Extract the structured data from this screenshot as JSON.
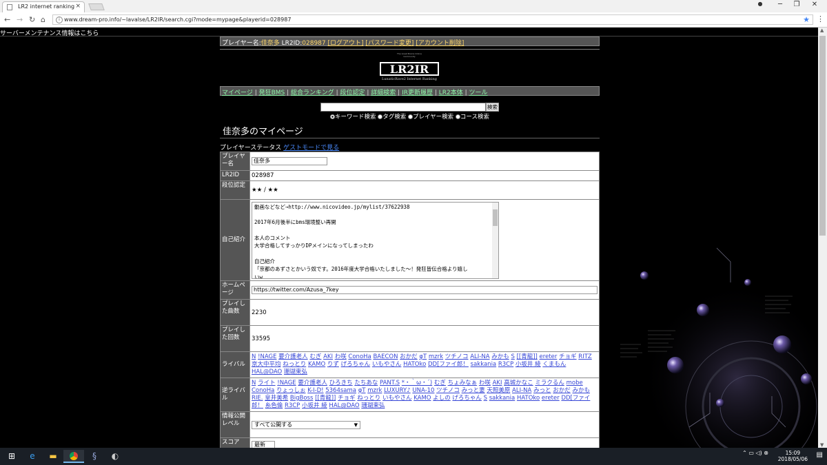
{
  "browser": {
    "tab_title": "LR2 internet ranking",
    "tab_close": "×",
    "url": "www.dream-pro.info/~lavalse/LR2IR/search.cgi?mode=mypage&playerid=028987",
    "win_min": "─",
    "win_max": "❐",
    "win_close": "✕"
  },
  "page": {
    "maintenance_link": "サーバーメンテナンス情報はこちら",
    "userbar": {
      "prefix": "プレイヤー名:",
      "player_name": "佳奈多",
      "id_prefix": " LR2ID:",
      "id": "028987",
      "logout": "[ログアウト]",
      "change_password": "[パスワード変更]",
      "delete_account": "[アカウント削除]"
    },
    "logo": {
      "title": "LR2IR",
      "subtitle": "LunaticRave2 Internet Ranking",
      "tiny": "The Great Brains Online Community"
    },
    "nav": [
      "マイページ",
      "発狂BMS",
      "総合ランキング",
      "段位認定",
      "詳細検索",
      "IR更新履歴",
      "LR2本体",
      "ツール"
    ],
    "search": {
      "button": "検索",
      "options": [
        "キーワード検索",
        "タグ検索",
        "プレイヤー検索",
        "コース検索"
      ],
      "selected_index": 0
    },
    "title": "佳奈多のマイページ",
    "status_label": "プレイヤーステータス",
    "guest_link": "ゲストモードで見る",
    "profile": {
      "player_name_label": "プレイヤー名",
      "player_name": "佳奈多",
      "lr2id_label": "LR2ID",
      "lr2id": "028987",
      "dan_label": "段位認定",
      "dan": "★★ / ★★",
      "intro_label": "自己紹介",
      "intro_lines": [
        "動画などなど→http://www.nicovideo.jp/mylist/37622938",
        "",
        "2017年6月後半にbms環境整い再開",
        "",
        "本人のコメント",
        "大学合格してすっかりDPメインになってしまったわ",
        "",
        "自己紹介",
        "「京都のあずさとかいう奴です。2016年度大学合格いたしました〜！発狂皆伝合格より嬉し",
        "いw"
      ],
      "homepage_label": "ホームページ",
      "homepage": "https://twitter.com/Azusa_7key",
      "songs_label": "プレイした曲数",
      "songs": "2230",
      "plays_label": "プレイした回数",
      "plays": "33595",
      "rivals_label": "ライバル",
      "rivals": [
        "N",
        "!NAGE",
        "要介護老人",
        "むぎ",
        "AKI",
        "わ咲",
        "ConoHa",
        "BAECON",
        "おかだ",
        "φT",
        "mzrk",
        "ツチノコ",
        "ALI-NA",
        "みかも",
        "S",
        "[[青龍]]",
        "ereter",
        "チョギ",
        "RITZ",
        "京大中平均",
        "ねっとり",
        "KAMO",
        "りず",
        "げろちゃん",
        "いもやさん",
        "HATOko",
        "DD[ファイ郎！",
        "sakkania",
        "R3CP",
        "小坂井 綾",
        "くまもん",
        "HAL@DAO",
        "珊瑚束弘"
      ],
      "reverse_rivals_label": "逆ライバル",
      "reverse_rivals": [
        "N",
        "ライト",
        "!NAGE",
        "要介護老人",
        "ひろきち",
        "たちあな",
        "PANT.S",
        "*・｀ω・´)",
        "むぎ",
        "ちょみなぁ",
        "わ咲",
        "AKI",
        "高城かなこ",
        "ミラクるん",
        "mobe",
        "ConoHa",
        "りょっしぉ",
        "K-I-D!",
        "5364sama",
        "φT",
        "mzrk",
        "LUXURY♪",
        "UNA-10",
        "ツチノコ",
        "みっと妻",
        "天照美原",
        "ALI-NA",
        "みっと",
        "おかだ",
        "みかも",
        "RIE.",
        "皇井美希",
        "BigBoss",
        "[[青龍]]",
        "チョギ",
        "ねっとり",
        "いもやさん",
        "KAMO",
        "よしの",
        "げろちゃん",
        "S",
        "sakkania",
        "HATOko",
        "ereter",
        "DD[ファイ郎！",
        "糸色倫",
        "R3CP",
        "小坂井 綾",
        "HAL@DAO",
        "珊瑚束弘"
      ],
      "privacy_label": "情報公開レベル",
      "privacy_value": "すべて公開する",
      "next_label": "スコア",
      "next_value": "最新"
    }
  },
  "taskbar": {
    "time": "15:09",
    "date": "2018/05/06"
  },
  "colors": {
    "background": "#000000",
    "header_bar": "#555555",
    "nav_link": "#8ef7a9",
    "userbar_link": "#ffd86b",
    "table_link": "#3545d6"
  }
}
